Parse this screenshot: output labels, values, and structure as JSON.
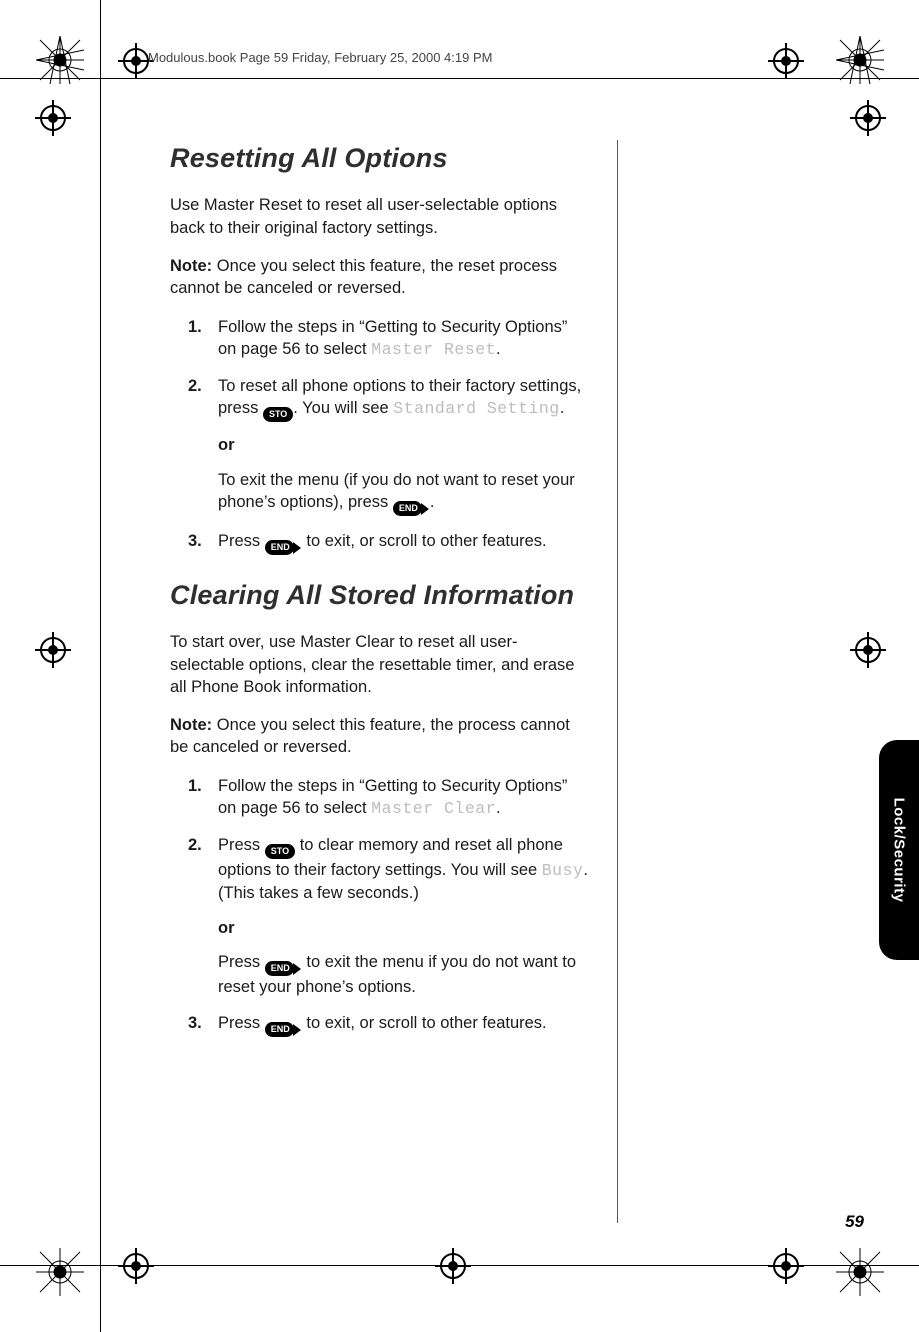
{
  "header": "Modulous.book  Page 59  Friday, February 25, 2000  4:19 PM",
  "page_number": "59",
  "tab_label": "Lock/Security",
  "sec1": {
    "title": "Resetting All Options",
    "intro": "Use Master Reset to reset all user-selectable options back to their original factory settings.",
    "note_label": "Note:",
    "note_text": " Once you select this feature, the reset process cannot be canceled or reversed.",
    "step1_num": "1.",
    "step1_a": "Follow the steps in “Getting to Security Options” on page 56 to select ",
    "step1_lcd": "Master Reset",
    "step1_b": ".",
    "step2_num": "2.",
    "step2_a": "To reset all phone options to their factory settings, press ",
    "step2_key": "STO",
    "step2_b": ". You will see ",
    "step2_lcd": "Standard Setting",
    "step2_c": ".",
    "or": "or",
    "step2_alt_a": "To exit the menu (if you do not want to reset your phone’s options), press ",
    "step2_alt_key": "END",
    "step2_alt_b": ".",
    "step3_num": "3.",
    "step3_a": "Press ",
    "step3_key": "END",
    "step3_b": " to exit, or scroll to other features."
  },
  "sec2": {
    "title": "Clearing All Stored Information",
    "intro": "To start over, use Master Clear to reset all user-selectable options, clear the resettable timer, and erase all Phone Book information.",
    "note_label": "Note:",
    "note_text": " Once you select this feature, the process cannot be canceled or reversed.",
    "step1_num": "1.",
    "step1_a": "Follow the steps in “Getting to Security Options” on page 56 to select ",
    "step1_lcd": "Master Clear",
    "step1_b": ".",
    "step2_num": "2.",
    "step2_a": "Press ",
    "step2_key": "STO",
    "step2_b": " to clear memory and reset all phone options to their factory settings. You will see ",
    "step2_lcd": "Busy",
    "step2_c": ". (This takes a few seconds.)",
    "or": "or",
    "step2_alt_a": "Press ",
    "step2_alt_key": "END",
    "step2_alt_b": " to exit the menu if you do not want to reset your phone’s options.",
    "step3_num": "3.",
    "step3_a": "Press ",
    "step3_key": "END",
    "step3_b": " to exit, or scroll to other features."
  }
}
